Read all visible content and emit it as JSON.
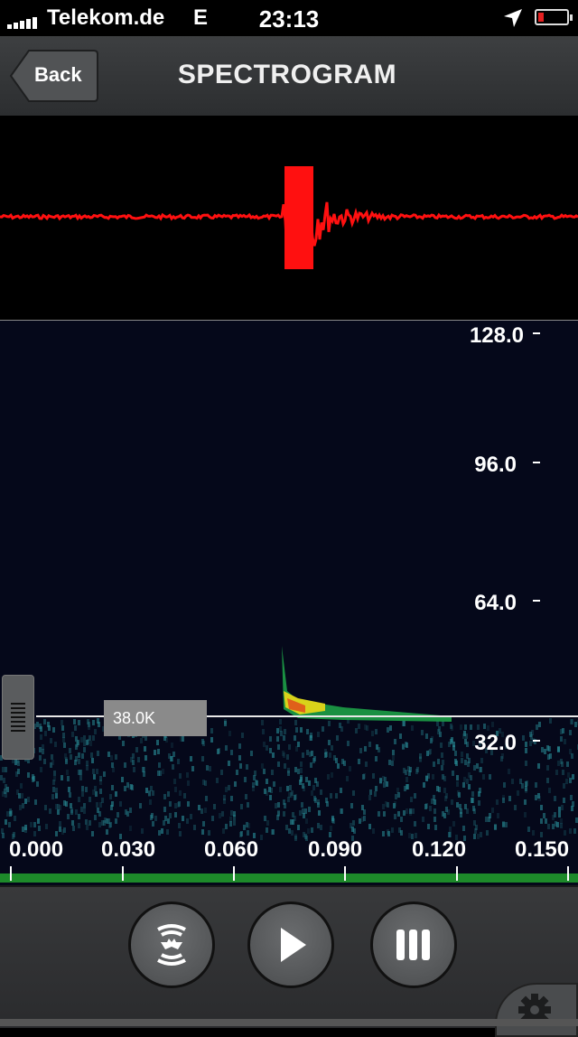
{
  "status_bar": {
    "carrier": "Telekom.de",
    "network": "E",
    "time": "23:13"
  },
  "nav": {
    "back_label": "Back",
    "title": "SPECTROGRAM"
  },
  "spectrogram": {
    "y_axis_labels": [
      "128.0",
      "96.0",
      "64.0",
      "32.0"
    ],
    "x_axis_labels": [
      "0.000",
      "0.030",
      "0.060",
      "0.090",
      "0.120",
      "0.150"
    ],
    "frequency_marker": "38.0K"
  },
  "colors": {
    "waveform": "#ff1010",
    "spectrogram_bg": "#05081a",
    "timeline": "#1d8a2a"
  },
  "toolbar": {
    "buttons": [
      "bat-detect-icon",
      "play-icon",
      "pause-icon"
    ],
    "settings": "gear-icon"
  }
}
